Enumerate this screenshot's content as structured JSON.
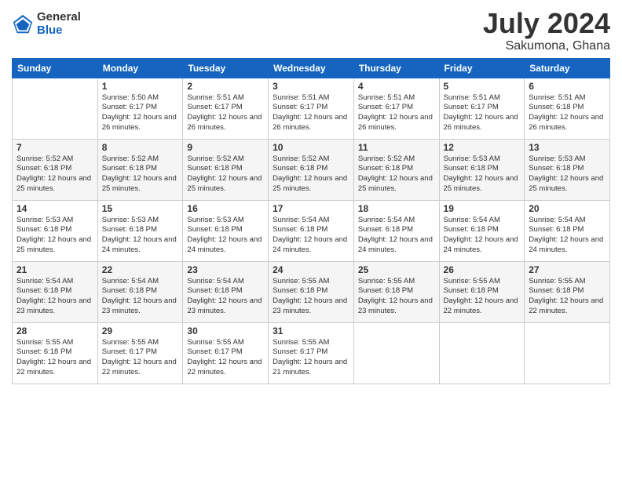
{
  "header": {
    "logo": {
      "line1": "General",
      "line2": "Blue"
    },
    "title": "July 2024",
    "location": "Sakumona, Ghana"
  },
  "weekdays": [
    "Sunday",
    "Monday",
    "Tuesday",
    "Wednesday",
    "Thursday",
    "Friday",
    "Saturday"
  ],
  "weeks": [
    [
      {
        "day": "",
        "sunrise": "",
        "sunset": "",
        "daylight": ""
      },
      {
        "day": "1",
        "sunrise": "Sunrise: 5:50 AM",
        "sunset": "Sunset: 6:17 PM",
        "daylight": "Daylight: 12 hours and 26 minutes."
      },
      {
        "day": "2",
        "sunrise": "Sunrise: 5:51 AM",
        "sunset": "Sunset: 6:17 PM",
        "daylight": "Daylight: 12 hours and 26 minutes."
      },
      {
        "day": "3",
        "sunrise": "Sunrise: 5:51 AM",
        "sunset": "Sunset: 6:17 PM",
        "daylight": "Daylight: 12 hours and 26 minutes."
      },
      {
        "day": "4",
        "sunrise": "Sunrise: 5:51 AM",
        "sunset": "Sunset: 6:17 PM",
        "daylight": "Daylight: 12 hours and 26 minutes."
      },
      {
        "day": "5",
        "sunrise": "Sunrise: 5:51 AM",
        "sunset": "Sunset: 6:17 PM",
        "daylight": "Daylight: 12 hours and 26 minutes."
      },
      {
        "day": "6",
        "sunrise": "Sunrise: 5:51 AM",
        "sunset": "Sunset: 6:18 PM",
        "daylight": "Daylight: 12 hours and 26 minutes."
      }
    ],
    [
      {
        "day": "7",
        "sunrise": "Sunrise: 5:52 AM",
        "sunset": "Sunset: 6:18 PM",
        "daylight": "Daylight: 12 hours and 25 minutes."
      },
      {
        "day": "8",
        "sunrise": "Sunrise: 5:52 AM",
        "sunset": "Sunset: 6:18 PM",
        "daylight": "Daylight: 12 hours and 25 minutes."
      },
      {
        "day": "9",
        "sunrise": "Sunrise: 5:52 AM",
        "sunset": "Sunset: 6:18 PM",
        "daylight": "Daylight: 12 hours and 25 minutes."
      },
      {
        "day": "10",
        "sunrise": "Sunrise: 5:52 AM",
        "sunset": "Sunset: 6:18 PM",
        "daylight": "Daylight: 12 hours and 25 minutes."
      },
      {
        "day": "11",
        "sunrise": "Sunrise: 5:52 AM",
        "sunset": "Sunset: 6:18 PM",
        "daylight": "Daylight: 12 hours and 25 minutes."
      },
      {
        "day": "12",
        "sunrise": "Sunrise: 5:53 AM",
        "sunset": "Sunset: 6:18 PM",
        "daylight": "Daylight: 12 hours and 25 minutes."
      },
      {
        "day": "13",
        "sunrise": "Sunrise: 5:53 AM",
        "sunset": "Sunset: 6:18 PM",
        "daylight": "Daylight: 12 hours and 25 minutes."
      }
    ],
    [
      {
        "day": "14",
        "sunrise": "Sunrise: 5:53 AM",
        "sunset": "Sunset: 6:18 PM",
        "daylight": "Daylight: 12 hours and 25 minutes."
      },
      {
        "day": "15",
        "sunrise": "Sunrise: 5:53 AM",
        "sunset": "Sunset: 6:18 PM",
        "daylight": "Daylight: 12 hours and 24 minutes."
      },
      {
        "day": "16",
        "sunrise": "Sunrise: 5:53 AM",
        "sunset": "Sunset: 6:18 PM",
        "daylight": "Daylight: 12 hours and 24 minutes."
      },
      {
        "day": "17",
        "sunrise": "Sunrise: 5:54 AM",
        "sunset": "Sunset: 6:18 PM",
        "daylight": "Daylight: 12 hours and 24 minutes."
      },
      {
        "day": "18",
        "sunrise": "Sunrise: 5:54 AM",
        "sunset": "Sunset: 6:18 PM",
        "daylight": "Daylight: 12 hours and 24 minutes."
      },
      {
        "day": "19",
        "sunrise": "Sunrise: 5:54 AM",
        "sunset": "Sunset: 6:18 PM",
        "daylight": "Daylight: 12 hours and 24 minutes."
      },
      {
        "day": "20",
        "sunrise": "Sunrise: 5:54 AM",
        "sunset": "Sunset: 6:18 PM",
        "daylight": "Daylight: 12 hours and 24 minutes."
      }
    ],
    [
      {
        "day": "21",
        "sunrise": "Sunrise: 5:54 AM",
        "sunset": "Sunset: 6:18 PM",
        "daylight": "Daylight: 12 hours and 23 minutes."
      },
      {
        "day": "22",
        "sunrise": "Sunrise: 5:54 AM",
        "sunset": "Sunset: 6:18 PM",
        "daylight": "Daylight: 12 hours and 23 minutes."
      },
      {
        "day": "23",
        "sunrise": "Sunrise: 5:54 AM",
        "sunset": "Sunset: 6:18 PM",
        "daylight": "Daylight: 12 hours and 23 minutes."
      },
      {
        "day": "24",
        "sunrise": "Sunrise: 5:55 AM",
        "sunset": "Sunset: 6:18 PM",
        "daylight": "Daylight: 12 hours and 23 minutes."
      },
      {
        "day": "25",
        "sunrise": "Sunrise: 5:55 AM",
        "sunset": "Sunset: 6:18 PM",
        "daylight": "Daylight: 12 hours and 23 minutes."
      },
      {
        "day": "26",
        "sunrise": "Sunrise: 5:55 AM",
        "sunset": "Sunset: 6:18 PM",
        "daylight": "Daylight: 12 hours and 22 minutes."
      },
      {
        "day": "27",
        "sunrise": "Sunrise: 5:55 AM",
        "sunset": "Sunset: 6:18 PM",
        "daylight": "Daylight: 12 hours and 22 minutes."
      }
    ],
    [
      {
        "day": "28",
        "sunrise": "Sunrise: 5:55 AM",
        "sunset": "Sunset: 6:18 PM",
        "daylight": "Daylight: 12 hours and 22 minutes."
      },
      {
        "day": "29",
        "sunrise": "Sunrise: 5:55 AM",
        "sunset": "Sunset: 6:17 PM",
        "daylight": "Daylight: 12 hours and 22 minutes."
      },
      {
        "day": "30",
        "sunrise": "Sunrise: 5:55 AM",
        "sunset": "Sunset: 6:17 PM",
        "daylight": "Daylight: 12 hours and 22 minutes."
      },
      {
        "day": "31",
        "sunrise": "Sunrise: 5:55 AM",
        "sunset": "Sunset: 6:17 PM",
        "daylight": "Daylight: 12 hours and 21 minutes."
      },
      {
        "day": "",
        "sunrise": "",
        "sunset": "",
        "daylight": ""
      },
      {
        "day": "",
        "sunrise": "",
        "sunset": "",
        "daylight": ""
      },
      {
        "day": "",
        "sunrise": "",
        "sunset": "",
        "daylight": ""
      }
    ]
  ]
}
